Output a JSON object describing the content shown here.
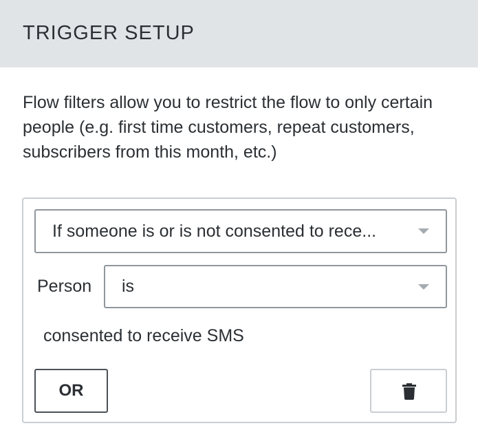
{
  "header": {
    "title": "TRIGGER SETUP"
  },
  "description": "Flow filters allow you to restrict the flow to only certain people (e.g. first time customers, repeat customers, subscribers from this month, etc.)",
  "filter": {
    "condition_select": {
      "selected": "If someone is or is not consented to rece...",
      "icon": "chevron-down-icon"
    },
    "person_label": "Person",
    "operator_select": {
      "selected": "is",
      "icon": "chevron-down-icon"
    },
    "consent_text": "consented to receive SMS",
    "or_button_label": "OR",
    "delete_button_icon": "trash-icon"
  },
  "colors": {
    "header_bg": "#e1e4e7",
    "text": "#2b2f33",
    "border": "#c9cdd1",
    "select_border": "#8f969c",
    "caret": "#a5abb0"
  }
}
